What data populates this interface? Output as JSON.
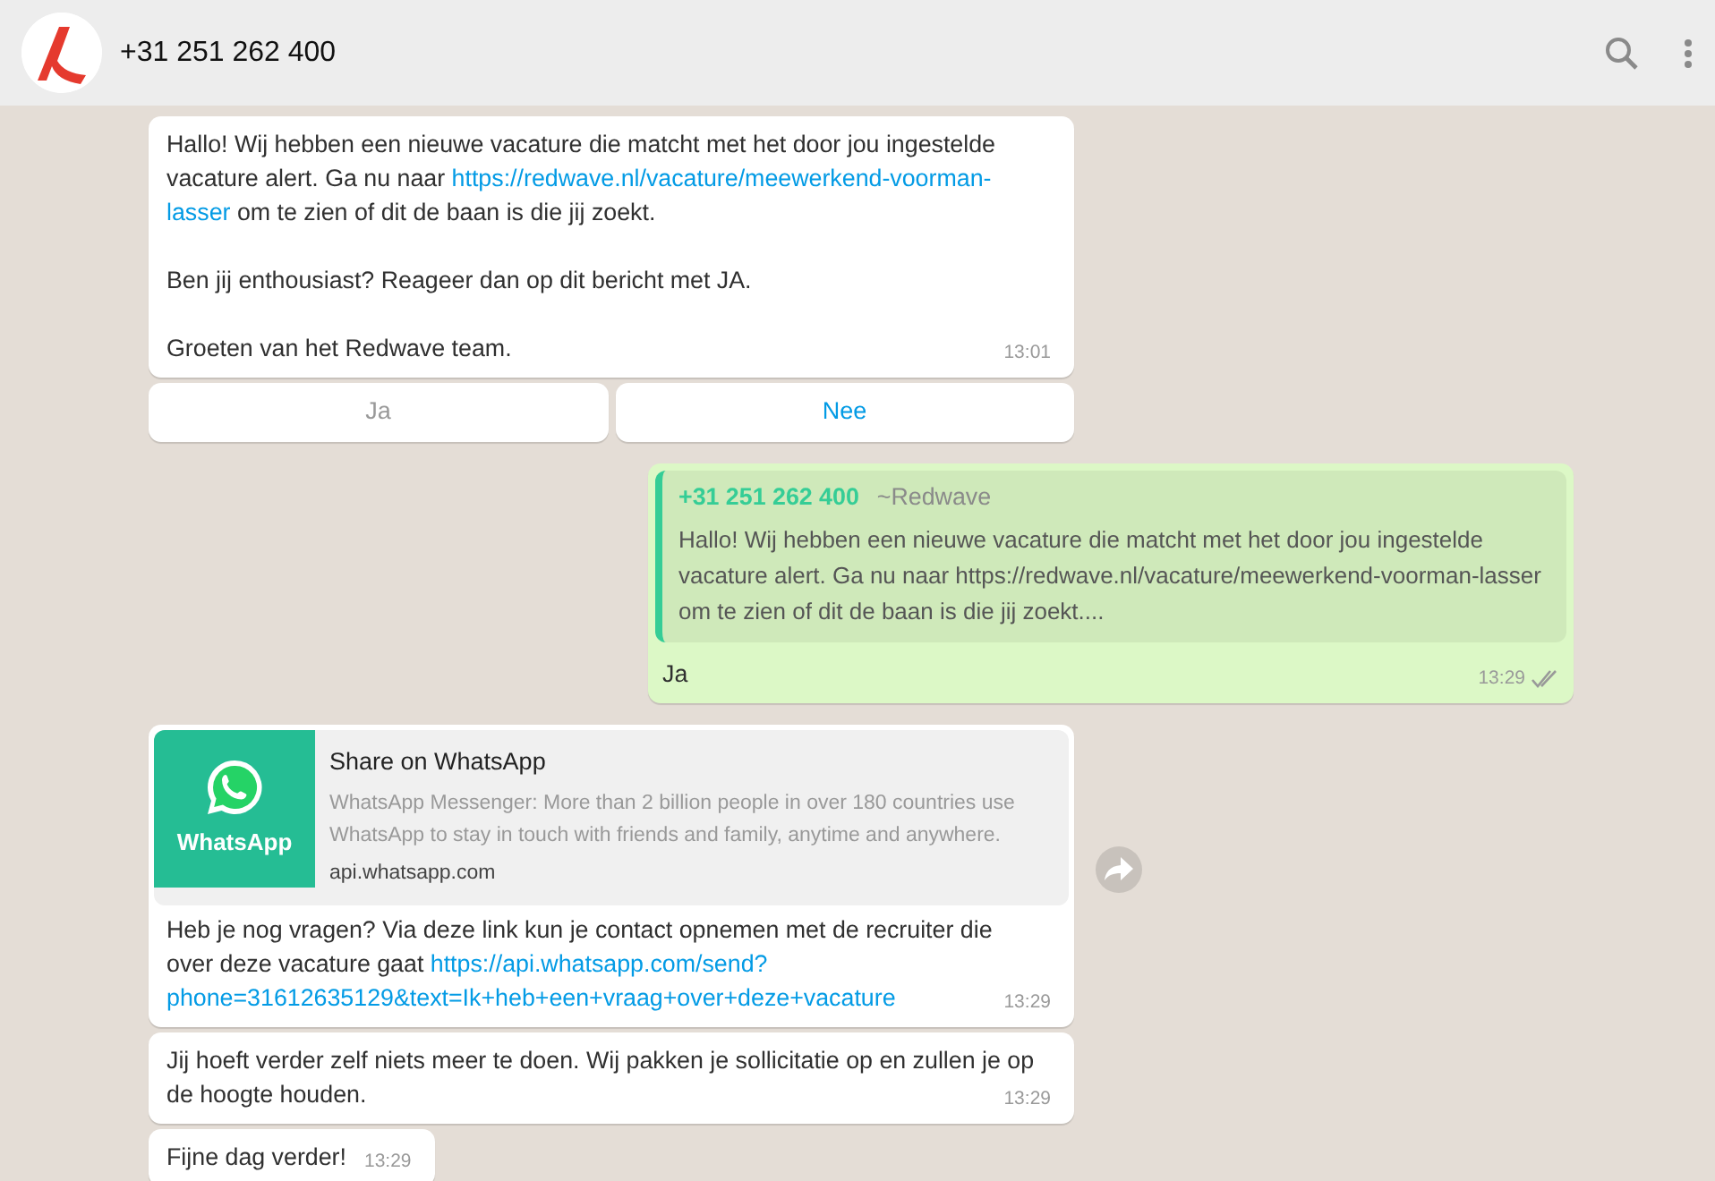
{
  "header": {
    "title": "+31 251 262 400"
  },
  "messages": [
    {
      "kind": "incoming",
      "body": [
        {
          "kind": "text",
          "text": "Hallo! Wij hebben een nieuwe vacature die matcht met het door jou ingestelde vacature alert. Ga nu naar "
        },
        {
          "kind": "link",
          "text": "https://redwave.nl/vacature/meewerkend-voorman-"
        },
        {
          "kind": "link",
          "text": "lasser"
        },
        {
          "kind": "text",
          "text": " om te zien of dit de baan is die jij zoekt.\n\nBen jij enthousiast? Reageer dan op dit bericht met JA.\n\nGroeten van het Redwave team."
        }
      ],
      "time": "13:01",
      "buttons": [
        {
          "label": "Ja",
          "disabled": true
        },
        {
          "label": "Nee",
          "disabled": false
        }
      ]
    },
    {
      "kind": "outgoing",
      "quote": {
        "author": "+31 251 262 400",
        "pushname": "~Redwave",
        "text": "Hallo! Wij hebben een nieuwe vacature die matcht met het door jou ingestelde vacature alert. Ga nu naar https://redwave.nl/vacature/meewerkend-voorman-lasser om te zien of dit de baan is die jij zoekt...."
      },
      "body": [
        {
          "kind": "text",
          "text": "Ja"
        }
      ],
      "time": "13:29"
    },
    {
      "kind": "incoming",
      "preview": {
        "thumbnail_label": "WhatsApp",
        "title": "Share on WhatsApp",
        "description": "WhatsApp Messenger: More than 2 billion people in over 180 countries use WhatsApp to stay in touch with friends and family, anytime and anywhere.",
        "domain": "api.whatsapp.com"
      },
      "body": [
        {
          "kind": "text",
          "text": "Heb je nog vragen? Via deze link kun je contact opnemen met de recruiter die over deze vacature gaat "
        },
        {
          "kind": "link",
          "text": "https://api.whatsapp.com/send?"
        },
        {
          "kind": "link",
          "text": "phone=31612635129&text=Ik+heb+een+vraag+over+deze+vacature"
        }
      ],
      "time": "13:29"
    },
    {
      "kind": "incoming",
      "body": [
        {
          "kind": "text",
          "text": "Jij hoeft verder zelf niets meer te doen. Wij pakken je sollicitatie op en zullen je op de hoogte houden."
        }
      ],
      "time": "13:29"
    },
    {
      "kind": "incoming",
      "body": [
        {
          "kind": "text",
          "text": "Fijne dag verder!"
        }
      ],
      "time": "13:29"
    }
  ]
}
